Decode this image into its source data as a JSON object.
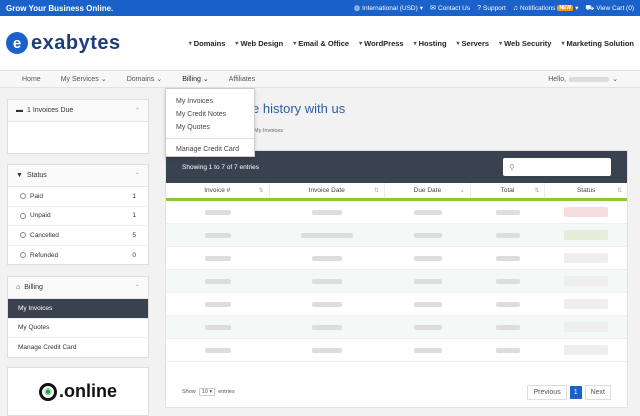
{
  "topbar": {
    "tagline": "Grow Your Business Online.",
    "links": [
      "International (USD)",
      "Contact Us",
      "Support",
      "Notifications",
      "View Cart (0)"
    ],
    "new_badge": "NEW"
  },
  "logo": {
    "mark": "e",
    "text": "exabytes"
  },
  "nav": [
    "Domains",
    "Web Design",
    "Email & Office",
    "WordPress",
    "Hosting",
    "Servers",
    "Web Security",
    "Marketing Solution"
  ],
  "subnav": {
    "items": [
      "Home",
      "My Services",
      "Domains",
      "Billing",
      "Affiliates"
    ],
    "hello": "Hello,"
  },
  "dropdown": [
    "My Invoices",
    "My Credit Notes",
    "My Quotes",
    "Manage Credit Card"
  ],
  "sidebar": {
    "invoices_due": "1 Invoices Due",
    "status_title": "Status",
    "statuses": [
      {
        "label": "Paid",
        "count": "1"
      },
      {
        "label": "Unpaid",
        "count": "1"
      },
      {
        "label": "Cancelled",
        "count": "5"
      },
      {
        "label": "Refunded",
        "count": "0"
      }
    ],
    "billing_title": "Billing",
    "billing_items": [
      "My Invoices",
      "My Quotes",
      "Manage Credit Card"
    ]
  },
  "promo": {
    "word": ".online"
  },
  "main": {
    "title_fragment": "es",
    "subtitle": "Your invoice history with us",
    "breadcrumb": "My Invoices",
    "showing": "Showing 1 to 7 of 7 entries",
    "columns": [
      "Invoice #",
      "Invoice Date",
      "Due Date",
      "Total",
      "Status"
    ],
    "show_label": "Show",
    "show_value": "10",
    "entries_label": "entries",
    "pager": {
      "prev": "Previous",
      "page": "1",
      "next": "Next"
    }
  },
  "colors": {
    "brand": "#1a61c9",
    "dark": "#3a4250",
    "accent_green": "#8cc63f"
  }
}
